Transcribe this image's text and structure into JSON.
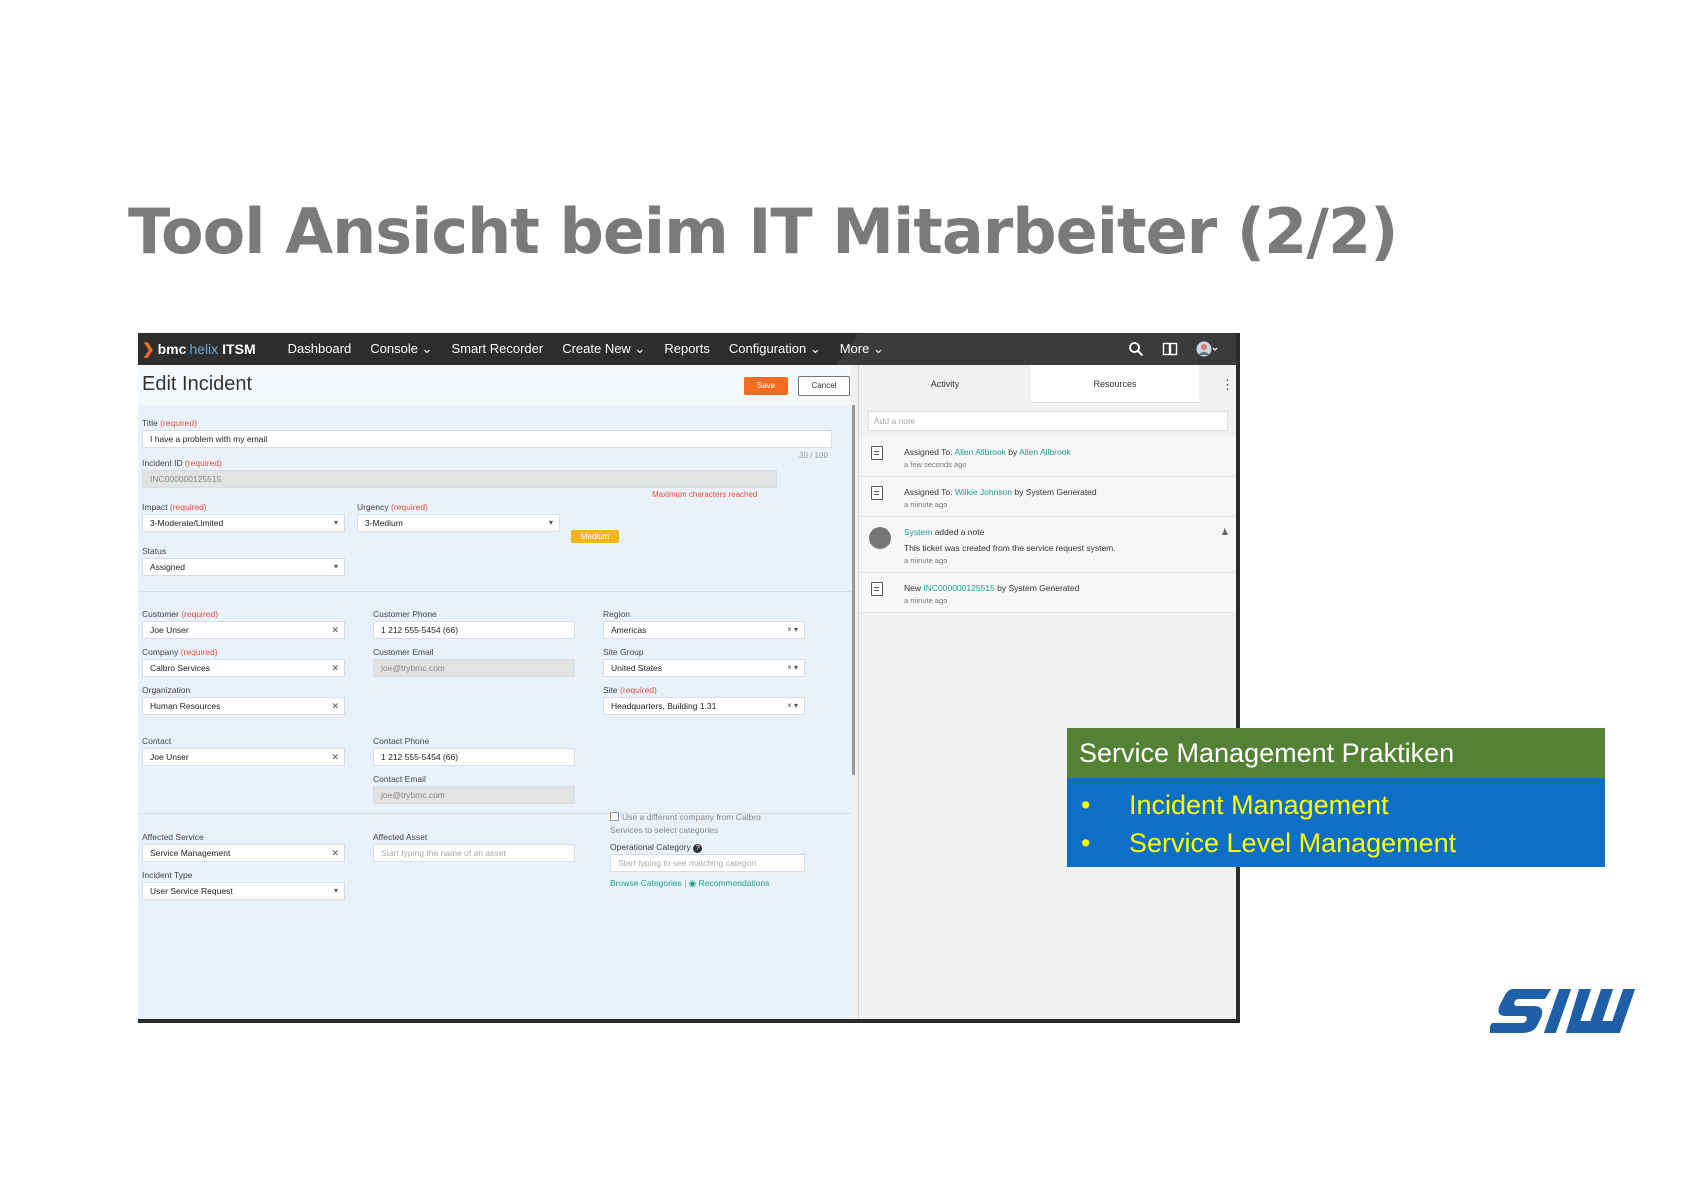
{
  "slide": {
    "title": "Tool Ansicht beim IT Mitarbeiter (2/2)",
    "logo_text": "SIW"
  },
  "navbar": {
    "brand_bmc": "bmc",
    "brand_helix": "helix",
    "brand_itsm": "ITSM",
    "links": [
      "Dashboard",
      "Console ⌄",
      "Smart Recorder",
      "Create New ⌄",
      "Reports",
      "Configuration ⌄",
      "More ⌄"
    ]
  },
  "form": {
    "title": "Edit Incident",
    "save_label": "Save",
    "cancel_label": "Cancel",
    "required": "(required)",
    "title_label": "Title",
    "title_value": "I have a problem with my email",
    "title_counter": "30 / 100",
    "max_chars_msg": "Maximum characters reached",
    "incident_id_label": "Incident ID",
    "incident_id_value": "INC000000125515",
    "impact_label": "Impact",
    "impact_value": "3-Moderate/Limited",
    "urgency_label": "Urgency",
    "urgency_value": "3-Medium",
    "priority_badge": "Medium",
    "status_label": "Status",
    "status_value": "Assigned",
    "customer_label": "Customer",
    "customer_value": "Joe Unser",
    "company_label": "Company",
    "company_value": "Calbro Services",
    "organization_label": "Organization",
    "organization_value": "Human Resources",
    "customer_phone_label": "Customer Phone",
    "customer_phone_value": "1 212 555-5454 (66)",
    "customer_email_label": "Customer Email",
    "customer_email_value": "joe@trybmc.com",
    "region_label": "Region",
    "region_value": "Americas",
    "site_group_label": "Site Group",
    "site_group_value": "United States",
    "site_label": "Site",
    "site_value": "Headquarters, Building 1.31",
    "contact_label": "Contact",
    "contact_value": "Joe Unser",
    "contact_phone_label": "Contact Phone",
    "contact_phone_value": "1 212 555-5454 (66)",
    "contact_email_label": "Contact Email",
    "contact_email_value": "joe@trybmc.com",
    "affected_service_label": "Affected Service",
    "affected_service_value": "Service Management",
    "incident_type_label": "Incident Type",
    "incident_type_value": "User Service Request",
    "affected_asset_label": "Affected Asset",
    "affected_asset_placeholder": "Start typing the name of an asset",
    "diff_company_line1": "Use a different company from Calbro",
    "diff_company_line2": "Services to select categories",
    "op_category_label": "Operational Category",
    "op_category_placeholder": "Start typing to see matching categori",
    "browse_categories": "Browse Categories",
    "link_sep": "|",
    "recommendations": "Recommendations"
  },
  "activity": {
    "tab_activity": "Activity",
    "tab_resources": "Resources",
    "note_placeholder": "Add a note",
    "feed": [
      {
        "prefix": "Assigned To: ",
        "link1": "Allen Allbrook",
        "mid": " by ",
        "link2": "Allen Allbrook",
        "time": "a few seconds ago"
      },
      {
        "prefix": "Assigned To: ",
        "link1": "Wilkie Johnson",
        "mid": " by System Generated",
        "time": "a minute ago"
      },
      {
        "link1": "System",
        "mid": " added a note",
        "body": "This ticket was created from the service request system.",
        "time": "a minute ago"
      },
      {
        "prefix": "New ",
        "link1": "INC000000125515",
        "mid": " by System Generated",
        "time": "a minute ago"
      }
    ]
  },
  "practices": {
    "heading": "Service Management Praktiken",
    "bullet": "•",
    "items": [
      "Incident Management",
      "Service Level Management"
    ]
  },
  "colors": {
    "accent_orange": "#f36d21",
    "teal_link": "#1a9f8f",
    "practice_green": "#548235",
    "practice_blue": "#0e6fc6",
    "practice_text": "#ffff00"
  }
}
